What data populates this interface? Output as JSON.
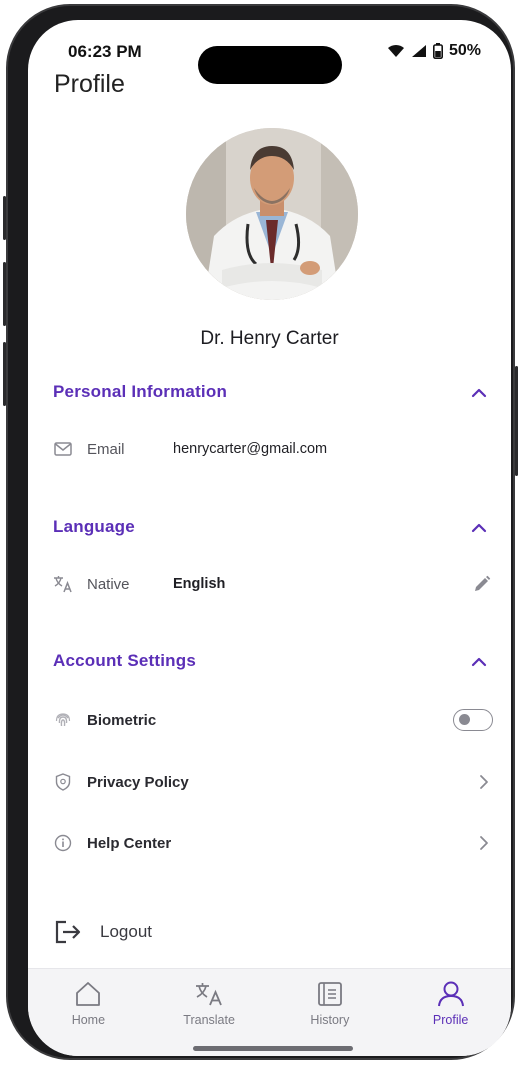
{
  "status_bar": {
    "time": "06:23 PM",
    "battery": "50%"
  },
  "page": {
    "title": "Profile"
  },
  "profile": {
    "name": "Dr. Henry Carter"
  },
  "personal_information": {
    "title": "Personal Information",
    "email_label": "Email",
    "email_value": "henrycarter@gmail.com"
  },
  "language": {
    "title": "Language",
    "native_label": "Native",
    "native_value": "English"
  },
  "account_settings": {
    "title": "Account Settings",
    "biometric_label": "Biometric",
    "biometric_enabled": false,
    "privacy_policy_label": "Privacy Policy",
    "help_center_label": "Help Center"
  },
  "logout_label": "Logout",
  "tabs": [
    {
      "label": "Home",
      "icon": "home-icon"
    },
    {
      "label": "Translate",
      "icon": "translate-icon"
    },
    {
      "label": "History",
      "icon": "history-icon"
    },
    {
      "label": "Profile",
      "icon": "profile-icon"
    }
  ],
  "active_tab": "Profile",
  "colors": {
    "accent": "#5b2fb7",
    "muted": "#8a8a92",
    "text": "#1f1f24"
  }
}
